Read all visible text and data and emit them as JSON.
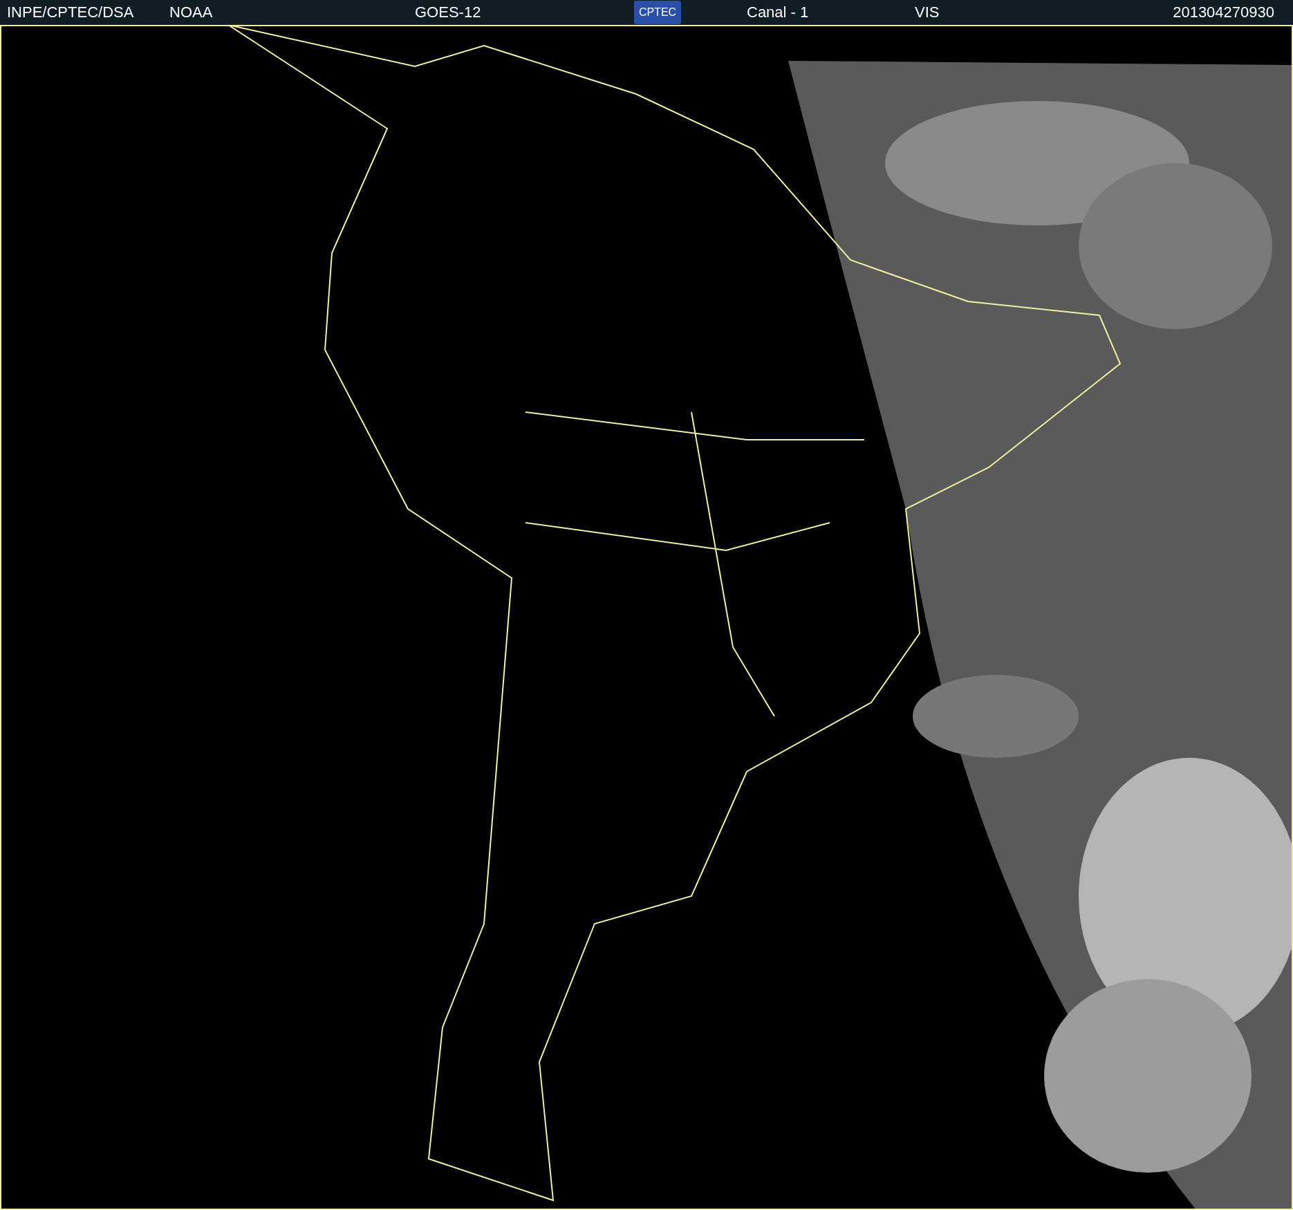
{
  "header": {
    "source": "INPE/CPTEC/DSA",
    "agency": "NOAA",
    "satellite": "GOES-12",
    "logo": "CPTEC",
    "channel": "Canal - 1",
    "band": "VIS",
    "timestamp": "201304270930"
  }
}
